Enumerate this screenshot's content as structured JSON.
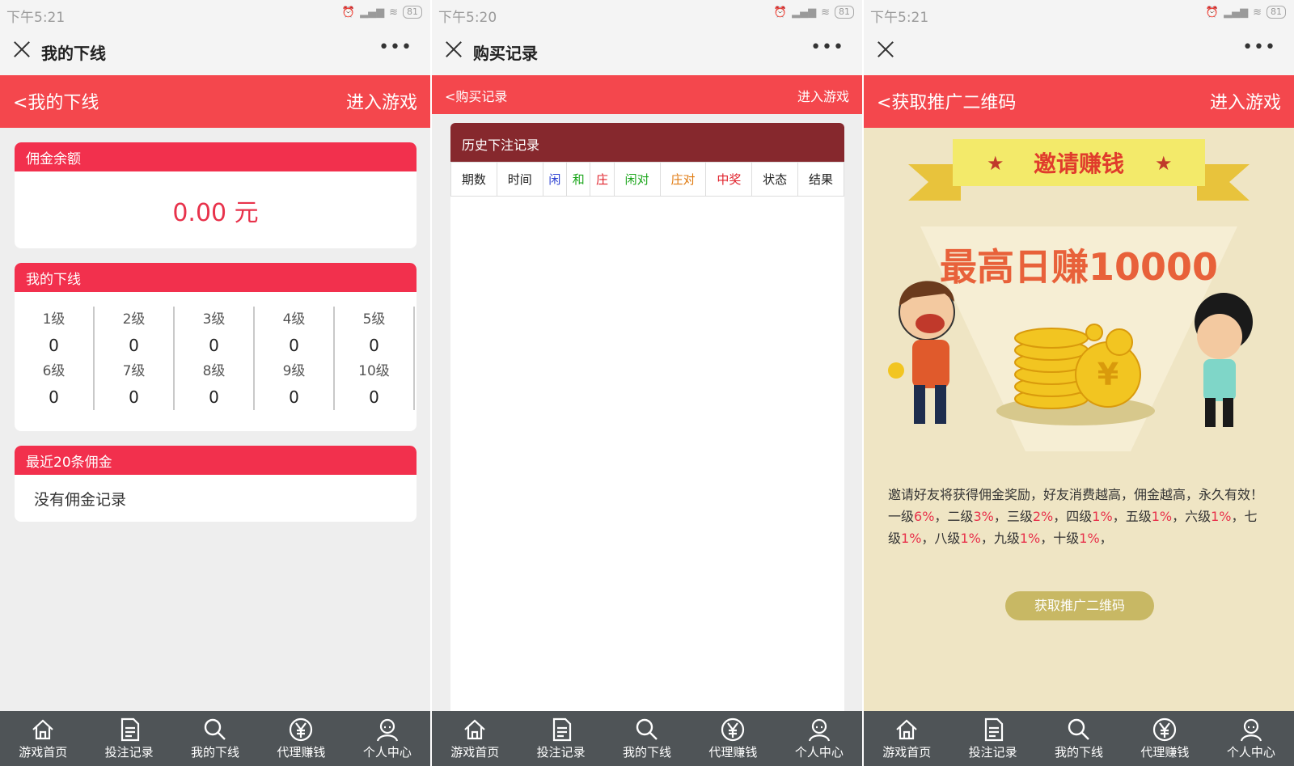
{
  "screens": [
    {
      "status_time": "下午5:21",
      "battery": "81",
      "title": "我的下线",
      "back": "<我的下线",
      "enter": "进入游戏",
      "balance_head": "佣金余额",
      "balance": "0.00 元",
      "downline_head": "我的下线",
      "levels": [
        {
          "label": "1级",
          "value": "0"
        },
        {
          "label": "2级",
          "value": "0"
        },
        {
          "label": "3级",
          "value": "0"
        },
        {
          "label": "4级",
          "value": "0"
        },
        {
          "label": "5级",
          "value": "0"
        },
        {
          "label": "6级",
          "value": "0"
        },
        {
          "label": "7级",
          "value": "0"
        },
        {
          "label": "8级",
          "value": "0"
        },
        {
          "label": "9级",
          "value": "0"
        },
        {
          "label": "10级",
          "value": "0"
        }
      ],
      "recent_head": "最近20条佣金",
      "no_record": "没有佣金记录"
    },
    {
      "status_time": "下午5:20",
      "battery": "81",
      "title": "购买记录",
      "back": "<购买记录",
      "enter": "进入游戏",
      "history_head": "历史下注记录",
      "columns": [
        {
          "label": "期数",
          "color": "#222222"
        },
        {
          "label": "时间",
          "color": "#222222"
        },
        {
          "label": "闲",
          "color": "#2a3fd1"
        },
        {
          "label": "和",
          "color": "#1aa51a"
        },
        {
          "label": "庄",
          "color": "#e0202a"
        },
        {
          "label": "闲对",
          "color": "#1aa51a"
        },
        {
          "label": "庄对",
          "color": "#e07a10"
        },
        {
          "label": "中奖",
          "color": "#e0202a"
        },
        {
          "label": "状态",
          "color": "#222222"
        },
        {
          "label": "结果",
          "color": "#222222"
        }
      ]
    },
    {
      "status_time": "下午5:21",
      "battery": "81",
      "back": "<获取推广二维码",
      "enter": "进入游戏",
      "banner": "邀请赚钱",
      "headline": "最高日赚10000",
      "desc1": "邀请好友将获得佣金奖励，好友消费越高，佣金越高，永久有效！",
      "rates": [
        {
          "level": "一级",
          "rate": "6%"
        },
        {
          "level": "二级",
          "rate": "3%"
        },
        {
          "level": "三级",
          "rate": "2%"
        },
        {
          "level": "四级",
          "rate": "1%"
        },
        {
          "level": "五级",
          "rate": "1%"
        },
        {
          "level": "六级",
          "rate": "1%"
        },
        {
          "level": "七级",
          "rate": "1%"
        },
        {
          "level": "八级",
          "rate": "1%"
        },
        {
          "level": "九级",
          "rate": "1%"
        },
        {
          "level": "十级",
          "rate": "1%"
        }
      ],
      "button": "获取推广二维码"
    }
  ],
  "tabbar": [
    {
      "label": "游戏首页",
      "icon": "home-icon"
    },
    {
      "label": "投注记录",
      "icon": "document-icon"
    },
    {
      "label": "我的下线",
      "icon": "search-icon"
    },
    {
      "label": "代理赚钱",
      "icon": "yuan-coin-icon"
    },
    {
      "label": "个人中心",
      "icon": "user-icon"
    }
  ],
  "colors": {
    "red_bar": "#f4474d",
    "card_head": "#f2304d",
    "history_head": "#86282d",
    "tabbar": "#4f5457",
    "promo_bg": "#efe5c4",
    "promo_button": "#c8b864"
  }
}
